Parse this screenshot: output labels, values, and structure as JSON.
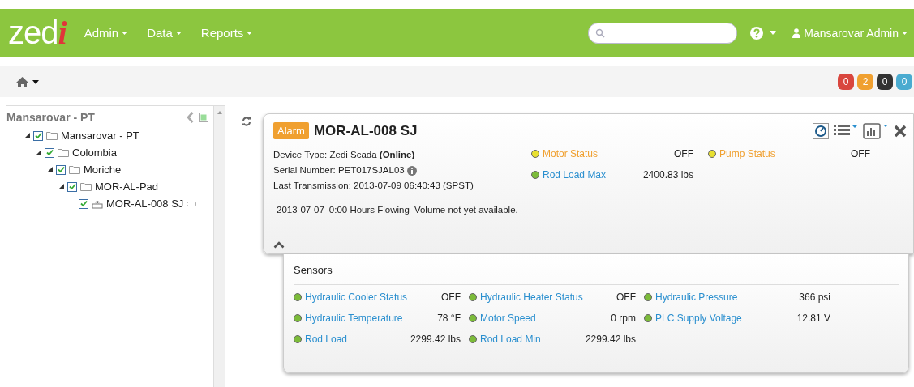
{
  "navbar": {
    "logo_main": "zed",
    "logo_accent": "i",
    "menus": [
      "Admin",
      "Data",
      "Reports"
    ],
    "user": "Mansarovar Admin"
  },
  "breadcrumb": {
    "badges": [
      {
        "count": "0",
        "color": "#d9463e"
      },
      {
        "count": "2",
        "color": "#f0a030"
      },
      {
        "count": "0",
        "color": "#333333"
      },
      {
        "count": "0",
        "color": "#4aabd0"
      }
    ]
  },
  "sidebar": {
    "title": "Mansarovar - PT",
    "tree": [
      {
        "label": "Mansarovar - PT",
        "kind": "folder",
        "checked": true,
        "expanded": true,
        "children": [
          {
            "label": "Colombia",
            "kind": "folder",
            "checked": true,
            "expanded": true,
            "children": [
              {
                "label": "Moriche",
                "kind": "folder",
                "checked": true,
                "expanded": true,
                "children": [
                  {
                    "label": "MOR-AL-Pad",
                    "kind": "folder",
                    "checked": true,
                    "expanded": true,
                    "children": [
                      {
                        "label": "MOR-AL-008 SJ",
                        "kind": "device",
                        "checked": true
                      }
                    ]
                  }
                ]
              }
            ]
          }
        ]
      }
    ]
  },
  "device": {
    "badge": "Alarm",
    "name": "MOR-AL-008 SJ",
    "device_type_label": "Device Type: Zedi Scada ",
    "device_status": "(Online)",
    "serial": "Serial Number: PET017SJAL03",
    "last_transmission": "Last Transmission: 2013-07-09 06:40:43 (SPST)",
    "flow": [
      "2013-07-07",
      "0:00 Hours Flowing",
      "Volume not yet available."
    ],
    "readings": [
      {
        "name": "Motor Status",
        "value": "OFF",
        "color": "#e8e030"
      },
      {
        "name": "Pump Status",
        "value": "OFF",
        "color": "#e8e030"
      },
      {
        "name": "Rod Load Max",
        "value": "2400.83 lbs",
        "color": "#7cbb3a"
      }
    ]
  },
  "sensors": {
    "title": "Sensors",
    "items": [
      {
        "name": "Hydraulic Cooler Status",
        "value": "OFF",
        "color": "#7cbb3a"
      },
      {
        "name": "Hydraulic Heater Status",
        "value": "OFF",
        "color": "#7cbb3a"
      },
      {
        "name": "Hydraulic Pressure",
        "value": "366 psi",
        "color": "#7cbb3a"
      },
      {
        "name": "Hydraulic Temperature",
        "value": "78 °F",
        "color": "#7cbb3a"
      },
      {
        "name": "Motor Speed",
        "value": "0 rpm",
        "color": "#7cbb3a"
      },
      {
        "name": "PLC Supply Voltage",
        "value": "12.81 V",
        "color": "#7cbb3a"
      },
      {
        "name": "Rod Load",
        "value": "2299.42 lbs",
        "color": "#7cbb3a"
      },
      {
        "name": "Rod Load Min",
        "value": "2299.42 lbs",
        "color": "#7cbb3a"
      }
    ]
  }
}
